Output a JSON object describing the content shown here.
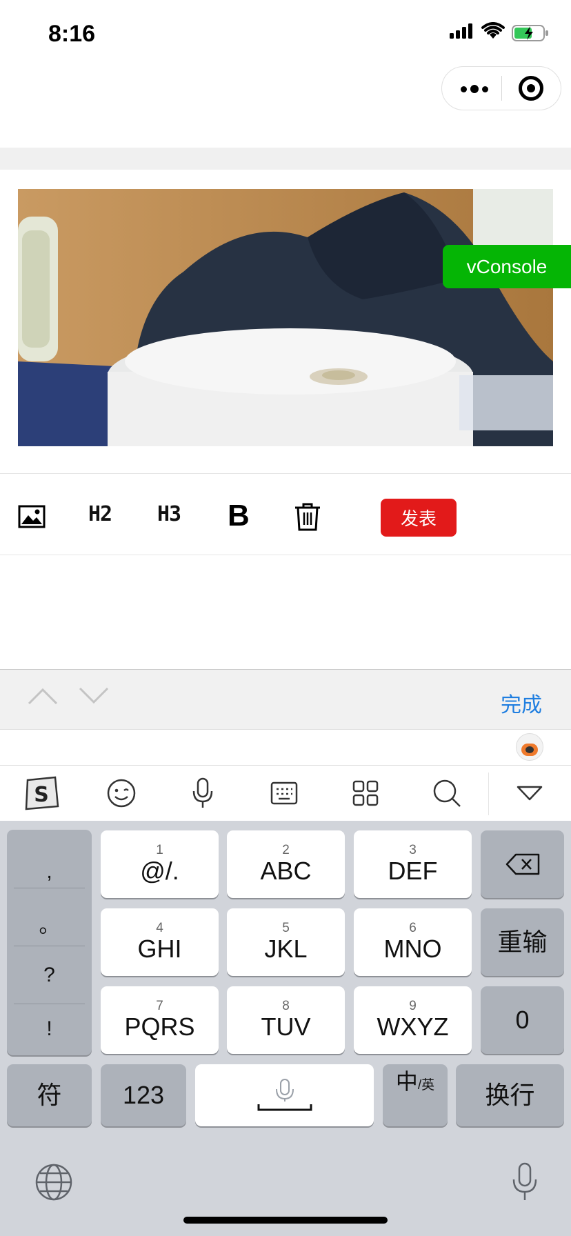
{
  "status_bar": {
    "time": "8:16"
  },
  "photo_overlay": {
    "vconsole_label": "vConsole"
  },
  "toolbar": {
    "image_icon": "image-icon",
    "h2_label": "H2",
    "h3_label": "H3",
    "bold_label": "B",
    "delete_icon": "trash-icon",
    "publish_label": "发表",
    "publish_color": "#e21a1a"
  },
  "keyboard_accessory": {
    "done_label": "完成",
    "done_color": "#1f7ee0"
  },
  "ime_toolbar": {
    "icons": [
      "sogou-logo-icon",
      "emoji-icon",
      "microphone-icon",
      "keyboard-icon",
      "apps-grid-icon",
      "search-icon",
      "hide-keyboard-icon"
    ]
  },
  "keyboard": {
    "punctuation": [
      ",",
      "。",
      "?",
      "!"
    ],
    "keys": [
      {
        "num": "1",
        "label": "@/."
      },
      {
        "num": "2",
        "label": "ABC"
      },
      {
        "num": "3",
        "label": "DEF"
      },
      {
        "num": "4",
        "label": "GHI"
      },
      {
        "num": "5",
        "label": "JKL"
      },
      {
        "num": "6",
        "label": "MNO"
      },
      {
        "num": "7",
        "label": "PQRS"
      },
      {
        "num": "8",
        "label": "TUV"
      },
      {
        "num": "9",
        "label": "WXYZ"
      }
    ],
    "retype_label": "重输",
    "zero_label": "0",
    "symbols_label": "符",
    "numbers_label": "123",
    "lang_main": "中",
    "lang_sub": "/英",
    "return_label": "换行"
  }
}
